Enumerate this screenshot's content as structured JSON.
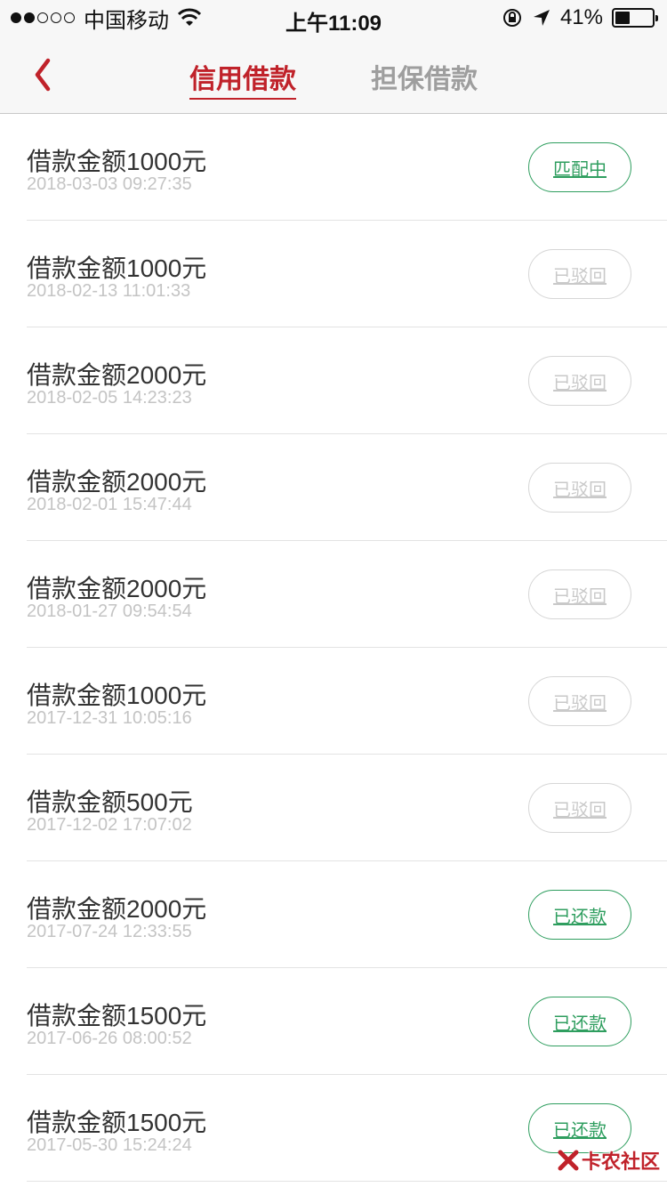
{
  "status_bar": {
    "carrier": "中国移动",
    "time": "上午11:09",
    "battery_text": "41%",
    "battery_level": 0.41
  },
  "nav": {
    "tabs": [
      {
        "label": "信用借款",
        "active": true
      },
      {
        "label": "担保借款",
        "active": false
      }
    ]
  },
  "loans": [
    {
      "amount": "借款金额1000元",
      "date": "2018-03-03 09:27:35",
      "status": "匹配中",
      "enabled": true
    },
    {
      "amount": "借款金额1000元",
      "date": "2018-02-13 11:01:33",
      "status": "已驳回",
      "enabled": false
    },
    {
      "amount": "借款金额2000元",
      "date": "2018-02-05 14:23:23",
      "status": "已驳回",
      "enabled": false
    },
    {
      "amount": "借款金额2000元",
      "date": "2018-02-01 15:47:44",
      "status": "已驳回",
      "enabled": false
    },
    {
      "amount": "借款金额2000元",
      "date": "2018-01-27 09:54:54",
      "status": "已驳回",
      "enabled": false
    },
    {
      "amount": "借款金额1000元",
      "date": "2017-12-31 10:05:16",
      "status": "已驳回",
      "enabled": false
    },
    {
      "amount": "借款金额500元",
      "date": "2017-12-02 17:07:02",
      "status": "已驳回",
      "enabled": false
    },
    {
      "amount": "借款金额2000元",
      "date": "2017-07-24 12:33:55",
      "status": "已还款",
      "enabled": true
    },
    {
      "amount": "借款金额1500元",
      "date": "2017-06-26 08:00:52",
      "status": "已还款",
      "enabled": true
    },
    {
      "amount": "借款金额1500元",
      "date": "2017-05-30 15:24:24",
      "status": "已还款",
      "enabled": true
    }
  ],
  "watermark": {
    "text": "卡农社区"
  },
  "colors": {
    "accent": "#c0222a",
    "success": "#2f9e5f",
    "disabled": "#d6d6d6"
  }
}
